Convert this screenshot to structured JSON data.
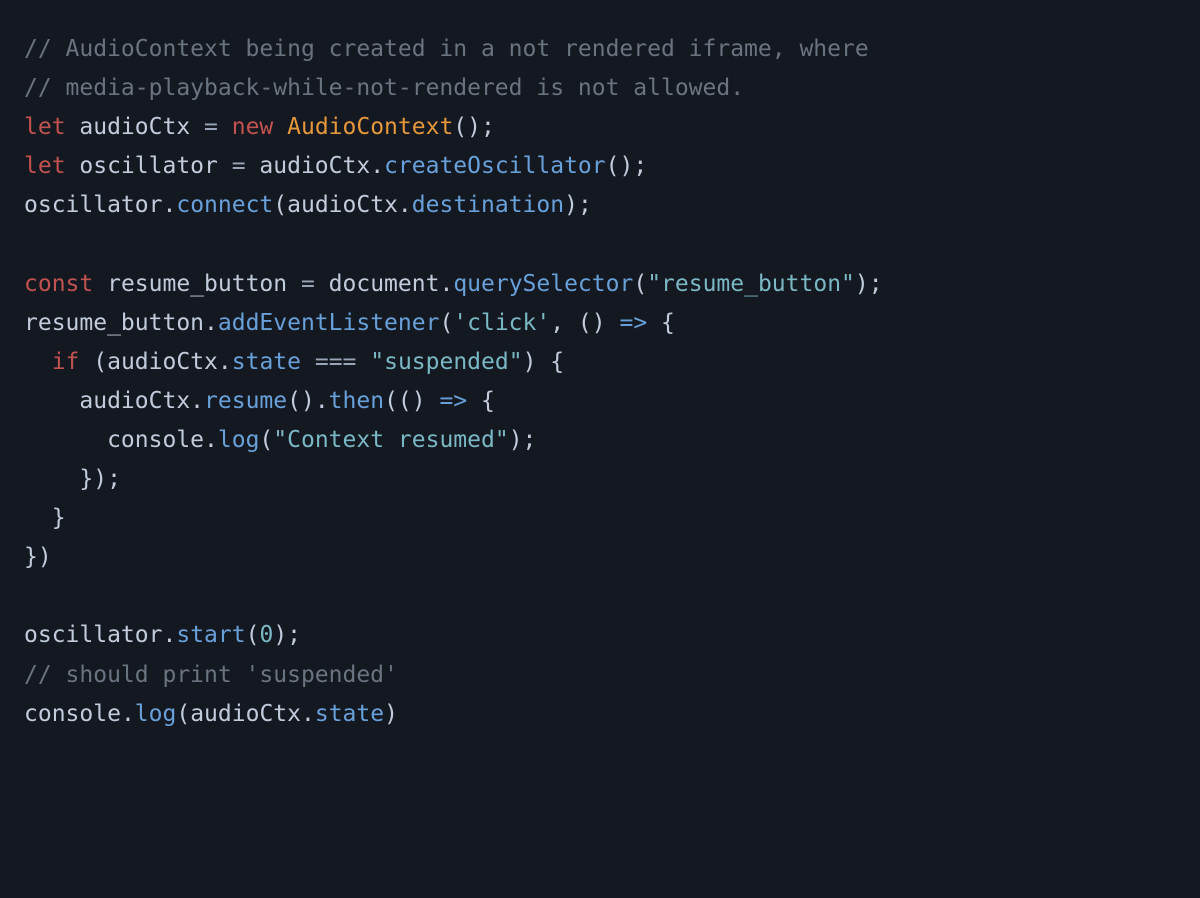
{
  "code": {
    "tokens": [
      [
        [
          "comment",
          "// AudioContext being created in a not rendered iframe, where"
        ]
      ],
      [
        [
          "comment",
          "// media-playback-while-not-rendered is not allowed."
        ]
      ],
      [
        [
          "keyword",
          "let"
        ],
        [
          "ident",
          " audioCtx "
        ],
        [
          "op",
          "= "
        ],
        [
          "keyword",
          "new "
        ],
        [
          "class",
          "AudioContext"
        ],
        [
          "punc",
          "();"
        ]
      ],
      [
        [
          "keyword",
          "let"
        ],
        [
          "ident",
          " oscillator "
        ],
        [
          "op",
          "= "
        ],
        [
          "ident",
          "audioCtx"
        ],
        [
          "punc",
          "."
        ],
        [
          "method",
          "createOscillator"
        ],
        [
          "punc",
          "();"
        ]
      ],
      [
        [
          "ident",
          "oscillator"
        ],
        [
          "punc",
          "."
        ],
        [
          "method",
          "connect"
        ],
        [
          "punc",
          "("
        ],
        [
          "ident",
          "audioCtx"
        ],
        [
          "punc",
          "."
        ],
        [
          "prop",
          "destination"
        ],
        [
          "punc",
          ");"
        ]
      ],
      [],
      [
        [
          "keyword",
          "const"
        ],
        [
          "ident",
          " resume_button "
        ],
        [
          "op",
          "= "
        ],
        [
          "ident",
          "document"
        ],
        [
          "punc",
          "."
        ],
        [
          "method",
          "querySelector"
        ],
        [
          "punc",
          "("
        ],
        [
          "string",
          "\"resume_button\""
        ],
        [
          "punc",
          ");"
        ]
      ],
      [
        [
          "ident",
          "resume_button"
        ],
        [
          "punc",
          "."
        ],
        [
          "method",
          "addEventListener"
        ],
        [
          "punc",
          "("
        ],
        [
          "string",
          "'click'"
        ],
        [
          "punc",
          ", () "
        ],
        [
          "arrow",
          "=>"
        ],
        [
          "punc",
          " {"
        ]
      ],
      [
        [
          "ident",
          "  "
        ],
        [
          "keyword",
          "if"
        ],
        [
          "punc",
          " ("
        ],
        [
          "ident",
          "audioCtx"
        ],
        [
          "punc",
          "."
        ],
        [
          "prop",
          "state"
        ],
        [
          "op",
          " === "
        ],
        [
          "string",
          "\"suspended\""
        ],
        [
          "punc",
          ") {"
        ]
      ],
      [
        [
          "ident",
          "    audioCtx"
        ],
        [
          "punc",
          "."
        ],
        [
          "method",
          "resume"
        ],
        [
          "punc",
          "()."
        ],
        [
          "method",
          "then"
        ],
        [
          "punc",
          "(() "
        ],
        [
          "arrow",
          "=>"
        ],
        [
          "punc",
          " {"
        ]
      ],
      [
        [
          "ident",
          "      console"
        ],
        [
          "punc",
          "."
        ],
        [
          "method",
          "log"
        ],
        [
          "punc",
          "("
        ],
        [
          "string",
          "\"Context resumed\""
        ],
        [
          "punc",
          ");"
        ]
      ],
      [
        [
          "punc",
          "    });"
        ]
      ],
      [
        [
          "punc",
          "  }"
        ]
      ],
      [
        [
          "punc",
          "})"
        ]
      ],
      [],
      [
        [
          "ident",
          "oscillator"
        ],
        [
          "punc",
          "."
        ],
        [
          "method",
          "start"
        ],
        [
          "punc",
          "("
        ],
        [
          "num",
          "0"
        ],
        [
          "punc",
          ");"
        ]
      ],
      [
        [
          "comment",
          "// should print 'suspended'"
        ]
      ],
      [
        [
          "ident",
          "console"
        ],
        [
          "punc",
          "."
        ],
        [
          "method",
          "log"
        ],
        [
          "punc",
          "("
        ],
        [
          "ident",
          "audioCtx"
        ],
        [
          "punc",
          "."
        ],
        [
          "prop",
          "state"
        ],
        [
          "punc",
          ")"
        ]
      ]
    ]
  }
}
